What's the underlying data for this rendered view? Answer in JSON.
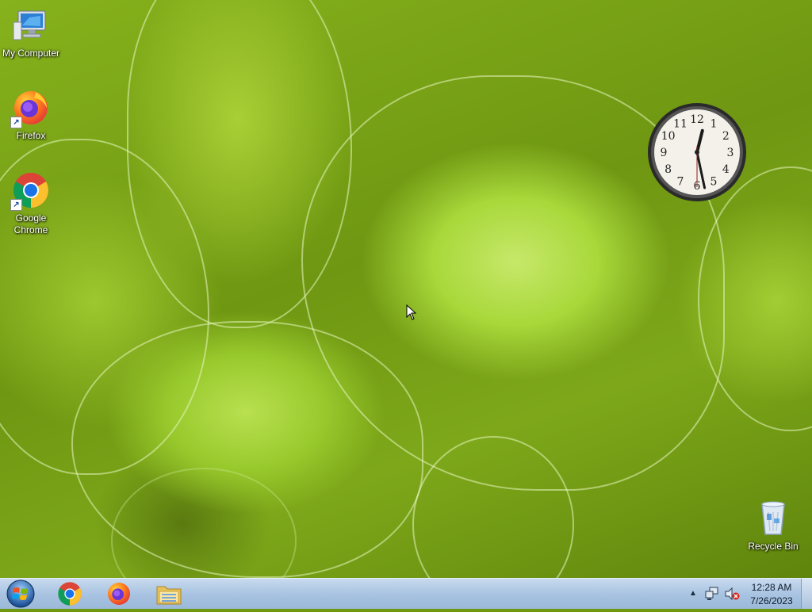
{
  "desktop": {
    "icons": [
      {
        "label": "My Computer",
        "icon": "computer-icon"
      },
      {
        "label": "Firefox",
        "icon": "firefox-icon"
      },
      {
        "label": "Google\nChrome",
        "icon": "chrome-icon"
      },
      {
        "label": "Recycle Bin",
        "icon": "recycle-bin-icon"
      }
    ],
    "clock_gadget": {
      "numerals": [
        "12",
        "1",
        "2",
        "3",
        "4",
        "5",
        "6",
        "7",
        "8",
        "9",
        "10",
        "11"
      ],
      "hour": 12,
      "minute": 28,
      "second": 30
    }
  },
  "taskbar": {
    "start": {
      "icon": "windows-logo-icon"
    },
    "pinned": [
      {
        "name": "Google Chrome",
        "icon": "chrome-icon"
      },
      {
        "name": "Firefox",
        "icon": "firefox-icon"
      },
      {
        "name": "Windows Explorer",
        "icon": "folder-icon"
      }
    ],
    "tray": {
      "expand_icon": "chevron-up-icon",
      "network_icon": "network-icon",
      "volume_icon": "volume-muted-icon",
      "time": "12:28 AM",
      "date": "7/26/2023"
    }
  },
  "colors": {
    "taskbar": "#a9c4e2",
    "wallpaper_accent": "#a8d83a"
  }
}
